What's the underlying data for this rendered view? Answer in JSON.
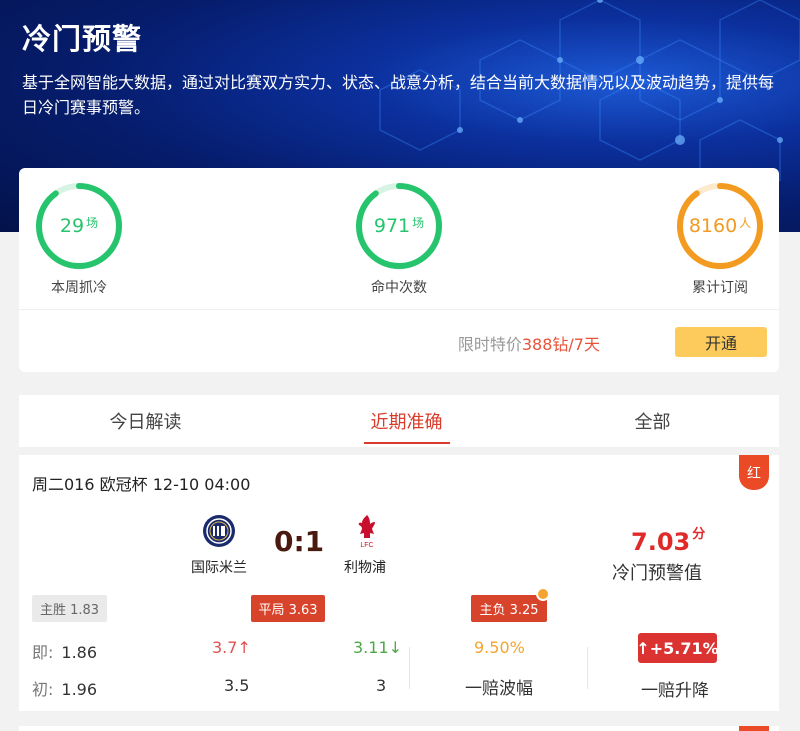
{
  "hero": {
    "title": "冷门预警",
    "description": "基于全网智能大数据，通过对比赛双方实力、状态、战意分析，结合当前大数据情况以及波动趋势，提供每日冷门赛事预警。"
  },
  "stats": [
    {
      "value": "29",
      "unit": "场",
      "label": "本周抓冷",
      "color": "#27c46e",
      "fill": 0.9
    },
    {
      "value": "971",
      "unit": "场",
      "label": "命中次数",
      "color": "#27c46e",
      "fill": 0.9
    },
    {
      "value": "8160",
      "unit": "人",
      "label": "累计订阅",
      "color": "#f39a20",
      "fill": 0.9
    }
  ],
  "promo": {
    "prefix": "限时特价",
    "price": "388钻/7天",
    "button": "开通"
  },
  "tabs": [
    {
      "label": "今日解读",
      "active": false
    },
    {
      "label": "近期准确",
      "active": true
    },
    {
      "label": "全部",
      "active": false
    }
  ],
  "match": {
    "header": "周二016 欧冠杯 12-10 04:00",
    "result_tag": "红",
    "home_team": "国际米兰",
    "away_team": "利物浦",
    "score": "0:1",
    "warning_value": "7.03",
    "warning_unit": "分",
    "warning_label": "冷门预警值",
    "badges": {
      "home_win": "主胜 1.83",
      "draw": "平局 3.63",
      "away_win": "主负 3.25"
    },
    "odds_live": {
      "label": "即:",
      "home": "1.86",
      "draw": "3.7",
      "away": "3.11"
    },
    "odds_init": {
      "label": "初:",
      "home": "1.96",
      "draw": "3.5",
      "away": "3"
    },
    "up_arrow": "↑",
    "down_arrow": "↓",
    "fluctuation_value": "9.50%",
    "fluctuation_label": "一赔波幅",
    "rise_value": "↑+5.71%",
    "rise_label": "一赔升降"
  }
}
